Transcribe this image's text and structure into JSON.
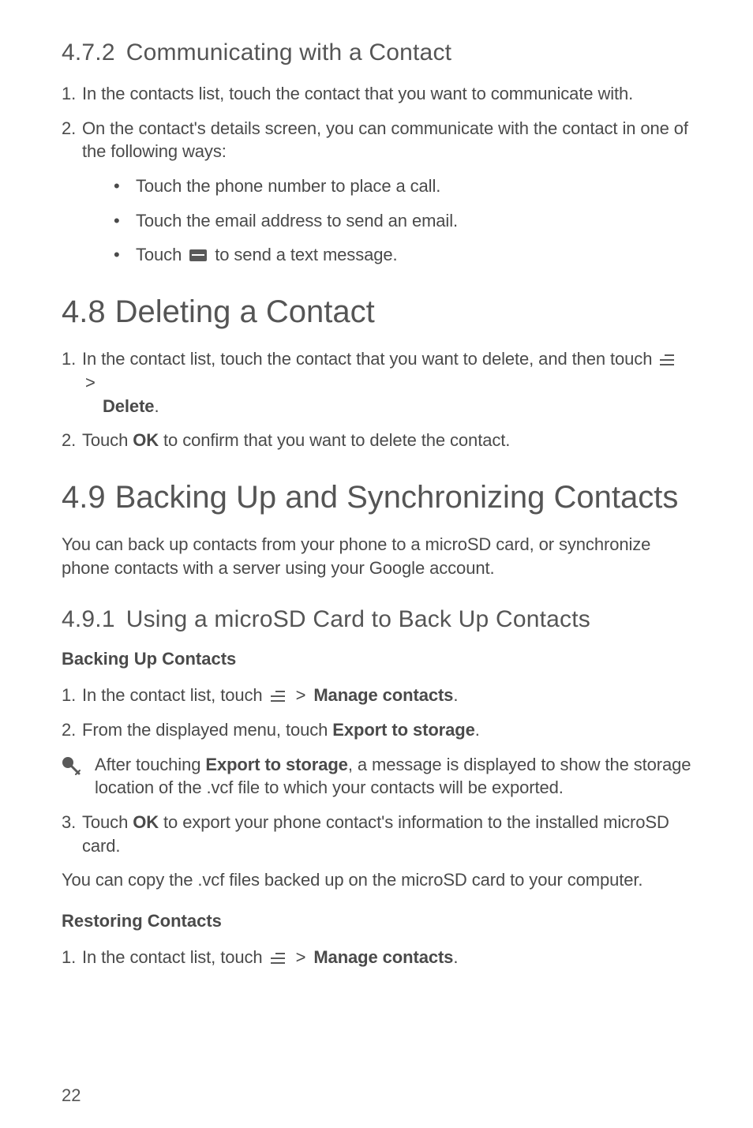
{
  "s472": {
    "num": "4.7.2",
    "title": "Communicating with a Contact",
    "step1": "In the contacts list, touch the contact that you want to communicate with.",
    "step2a": "On the contact's details screen, you can communicate with the contact in one of the following ways:",
    "bullets": [
      "Touch the phone number to place a call.",
      "Touch the email address to send an email."
    ],
    "bullet3_pre": "Touch",
    "bullet3_post": "to send a text message."
  },
  "s48": {
    "num": "4.8",
    "title": "Deleting a Contact",
    "step1_pre": "In the contact list, touch the contact that you want to delete, and then touch",
    "step1_delete": "Delete",
    "step1_period": ".",
    "step2_pre": "Touch ",
    "step2_ok": "OK",
    "step2_post": " to confirm that you want to delete the contact."
  },
  "s49": {
    "num": "4.9",
    "title": "Backing Up and Synchronizing Contacts",
    "intro": "You can back up contacts from your phone to a microSD card, or synchronize phone contacts with a server using your Google account."
  },
  "s491": {
    "num": "4.9.1",
    "title": "Using a microSD Card to Back Up Contacts",
    "backup_heading": "Backing Up Contacts",
    "b_step1_pre": "In the contact list, touch",
    "b_step1_gt": ">",
    "b_step1_bold": "Manage contacts",
    "b_step1_period": ".",
    "b_step2_pre": "From the displayed menu, touch ",
    "b_step2_bold": "Export to storage",
    "b_step2_period": ".",
    "note_pre": "After touching ",
    "note_bold": "Export to storage",
    "note_post": ", a message is displayed to show the storage location of the .vcf file to which your contacts will be exported.",
    "b_step3_pre": "Touch ",
    "b_step3_ok": "OK",
    "b_step3_post": " to export your phone contact's information to the installed microSD card.",
    "b_copy": "You can copy the .vcf files backed up on the microSD card to your computer.",
    "restore_heading": "Restoring Contacts",
    "r_step1_pre": "In the contact list, touch",
    "r_step1_gt": ">",
    "r_step1_bold": "Manage contacts",
    "r_step1_period": "."
  },
  "markers": {
    "n1": "1.",
    "n2": "2.",
    "n3": "3.",
    "dot": "•",
    "gt": ">"
  },
  "page": "22"
}
